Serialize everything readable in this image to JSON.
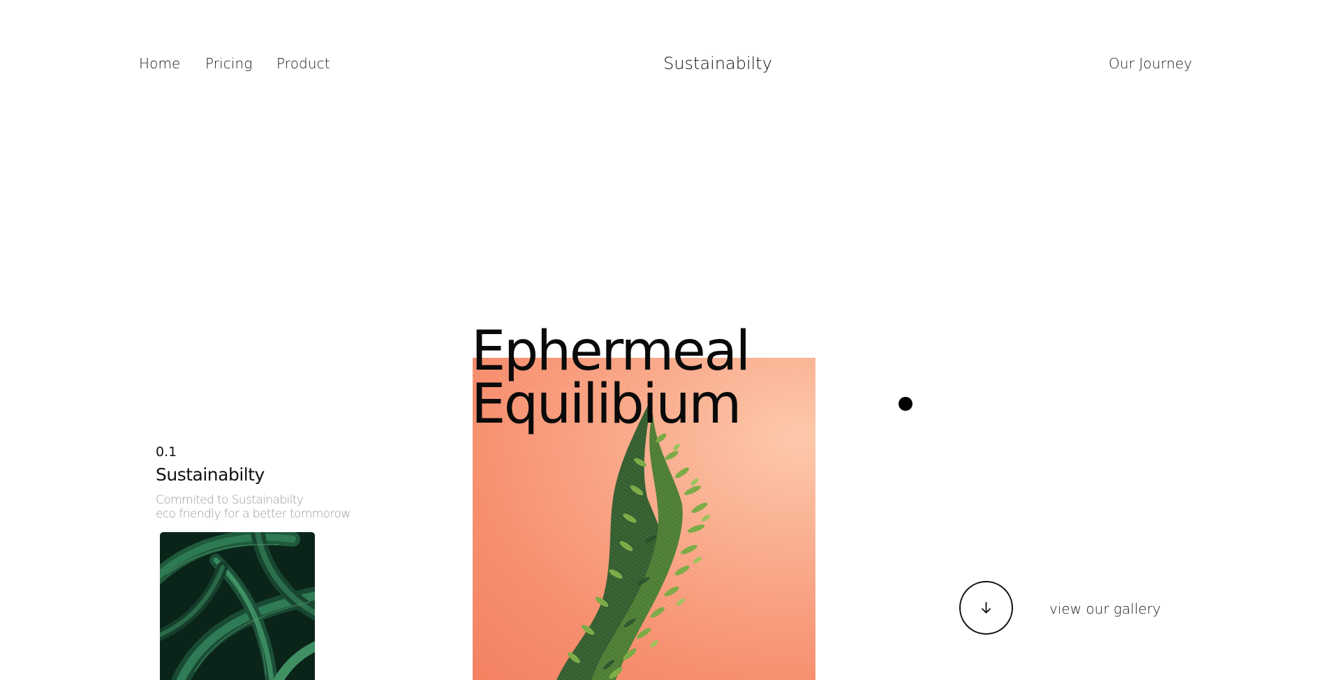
{
  "nav": {
    "links": [
      {
        "label": "Home"
      },
      {
        "label": "Pricing"
      },
      {
        "label": "Product"
      }
    ],
    "brand": "Sustainabilty",
    "journey_label": "Our Journey"
  },
  "hero": {
    "headline_line1": "Ephermeal",
    "headline_line2": "Equilibium",
    "image_background": "#f88f6e"
  },
  "info": {
    "number": "0.1",
    "title": "Sustainabilty",
    "description_line1": "Commited to Sustainabilty",
    "description_line2": "eco friendly for a better tommorow"
  },
  "gallery": {
    "label": "view our gallery",
    "icon": "arrow-down-icon"
  },
  "colors": {
    "text": "#111111",
    "muted": "#9a9a9a",
    "accent": "#f88f6e"
  }
}
